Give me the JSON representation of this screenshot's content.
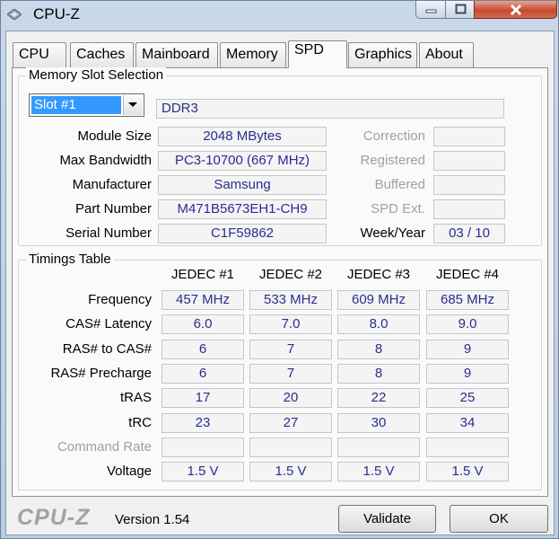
{
  "window": {
    "title": "CPU-Z"
  },
  "tabs": [
    {
      "label": "CPU"
    },
    {
      "label": "Caches"
    },
    {
      "label": "Mainboard"
    },
    {
      "label": "Memory"
    },
    {
      "label": "SPD",
      "active": true
    },
    {
      "label": "Graphics"
    },
    {
      "label": "About"
    }
  ],
  "slot_group": {
    "legend": "Memory Slot Selection",
    "slot_select": "Slot #1",
    "memory_type": "DDR3",
    "labels": {
      "module_size": "Module Size",
      "max_bandwidth": "Max Bandwidth",
      "manufacturer": "Manufacturer",
      "part_number": "Part Number",
      "serial_number": "Serial Number",
      "correction": "Correction",
      "registered": "Registered",
      "buffered": "Buffered",
      "spd_ext": "SPD Ext.",
      "week_year": "Week/Year"
    },
    "values": {
      "module_size": "2048 MBytes",
      "max_bandwidth": "PC3-10700 (667 MHz)",
      "manufacturer": "Samsung",
      "part_number": "M471B5673EH1-CH9",
      "serial_number": "C1F59862",
      "correction": "",
      "registered": "",
      "buffered": "",
      "spd_ext": "",
      "week_year": "03 / 10"
    }
  },
  "timings": {
    "legend": "Timings Table",
    "columns": [
      "JEDEC #1",
      "JEDEC #2",
      "JEDEC #3",
      "JEDEC #4"
    ],
    "rows": [
      {
        "label": "Frequency",
        "values": [
          "457 MHz",
          "533 MHz",
          "609 MHz",
          "685 MHz"
        ]
      },
      {
        "label": "CAS# Latency",
        "values": [
          "6.0",
          "7.0",
          "8.0",
          "9.0"
        ]
      },
      {
        "label": "RAS# to CAS#",
        "values": [
          "6",
          "7",
          "8",
          "9"
        ]
      },
      {
        "label": "RAS# Precharge",
        "values": [
          "6",
          "7",
          "8",
          "9"
        ]
      },
      {
        "label": "tRAS",
        "values": [
          "17",
          "20",
          "22",
          "25"
        ]
      },
      {
        "label": "tRC",
        "values": [
          "23",
          "27",
          "30",
          "34"
        ]
      },
      {
        "label": "Command Rate",
        "values": [
          "",
          "",
          "",
          ""
        ],
        "disabled": true
      },
      {
        "label": "Voltage",
        "values": [
          "1.5 V",
          "1.5 V",
          "1.5 V",
          "1.5 V"
        ]
      }
    ]
  },
  "footer": {
    "logo": "CPU-Z",
    "version": "Version 1.54",
    "validate_label": "Validate",
    "ok_label": "OK"
  },
  "colors": {
    "value_text": "#2a2d8f",
    "selection": "#3399ff",
    "close_button": "#c64a2e"
  }
}
